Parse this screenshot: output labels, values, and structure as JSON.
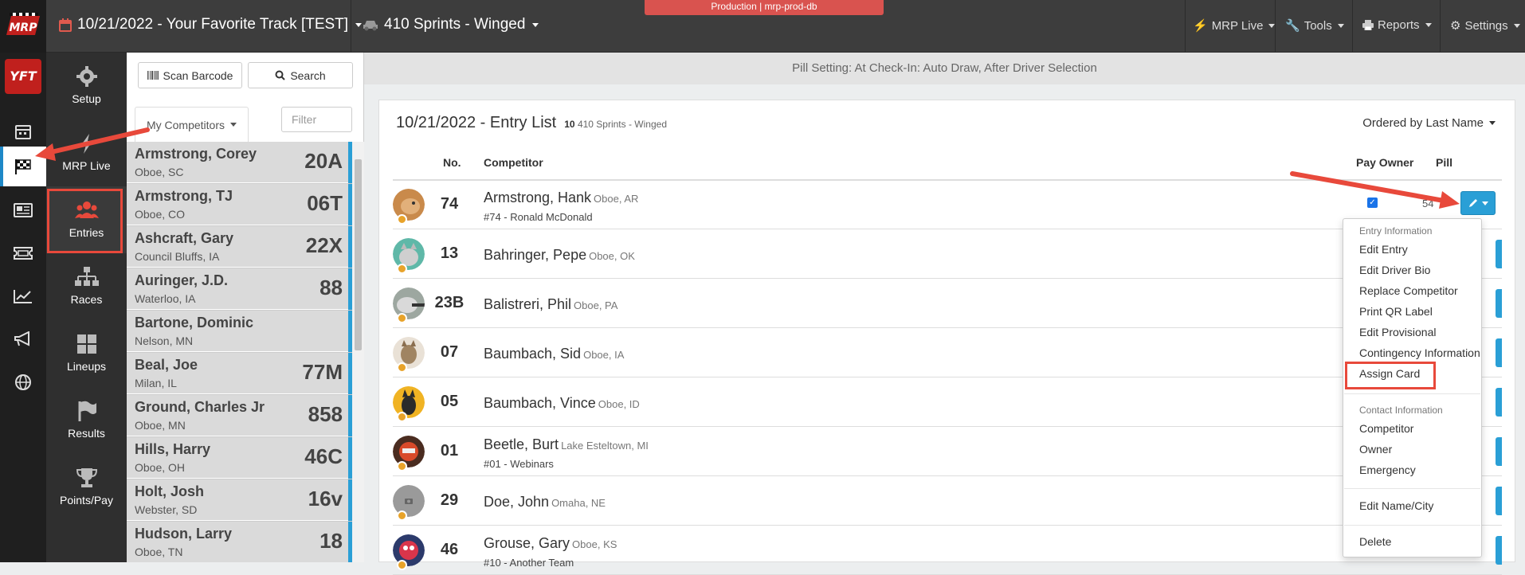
{
  "banner": "Production | mrp-prod-db",
  "topbar": {
    "event": "10/21/2022 - Your Favorite Track [TEST]",
    "division": "410 Sprints - Winged",
    "menus": [
      "MRP Live",
      "Tools",
      "Reports",
      "Settings"
    ]
  },
  "brand": {
    "logo_text": "MRP",
    "track_logo_text": "YFT"
  },
  "sidebar": {
    "items": [
      {
        "label": "Setup",
        "icon": "gear-icon"
      },
      {
        "label": "MRP Live",
        "icon": "bolt-icon"
      },
      {
        "label": "Entries",
        "icon": "users-icon"
      },
      {
        "label": "Races",
        "icon": "sitemap-icon"
      },
      {
        "label": "Lineups",
        "icon": "grid-icon"
      },
      {
        "label": "Results",
        "icon": "flag-icon"
      },
      {
        "label": "Points/Pay",
        "icon": "trophy-icon"
      }
    ]
  },
  "competitors": {
    "scan_label": "Scan Barcode",
    "search_label": "Search",
    "tab_label": "My Competitors",
    "filter_placeholder": "Filter",
    "list": [
      {
        "name": "Armstrong, Corey",
        "city": "Oboe, SC",
        "num": "20A"
      },
      {
        "name": "Armstrong, TJ",
        "city": "Oboe, CO",
        "num": "06T"
      },
      {
        "name": "Ashcraft, Gary",
        "city": "Council Bluffs, IA",
        "num": "22X"
      },
      {
        "name": "Auringer, J.D.",
        "city": "Waterloo, IA",
        "num": "88"
      },
      {
        "name": "Bartone, Dominic",
        "city": "Nelson, MN",
        "num": ""
      },
      {
        "name": "Beal, Joe",
        "city": "Milan, IL",
        "num": "77M"
      },
      {
        "name": "Ground, Charles Jr",
        "city": "Oboe, MN",
        "num": "858"
      },
      {
        "name": "Hills, Harry",
        "city": "Oboe, OH",
        "num": "46C"
      },
      {
        "name": "Holt, Josh",
        "city": "Webster, SD",
        "num": "16v"
      },
      {
        "name": "Hudson, Larry",
        "city": "Oboe, TN",
        "num": "18"
      }
    ]
  },
  "main": {
    "pill_setting": "Pill Setting: At Check-In: Auto Draw, After Driver Selection",
    "title": "10/21/2022 - Entry List",
    "count": "10",
    "division": "410 Sprints - Winged",
    "ordered": "Ordered by Last Name",
    "headers": {
      "no": "No.",
      "competitor": "Competitor",
      "pay_owner": "Pay Owner",
      "pill": "Pill"
    },
    "entries": [
      {
        "num": "74",
        "name": "Armstrong, Hank",
        "city": "Oboe, AR",
        "team": "#74 - Ronald McDonald",
        "pill": "54"
      },
      {
        "num": "13",
        "name": "Bahringer, Pepe",
        "city": "Oboe, OK",
        "team": ""
      },
      {
        "num": "23B",
        "name": "Balistreri, Phil",
        "city": "Oboe, PA",
        "team": ""
      },
      {
        "num": "07",
        "name": "Baumbach, Sid",
        "city": "Oboe, IA",
        "team": ""
      },
      {
        "num": "05",
        "name": "Baumbach, Vince",
        "city": "Oboe, ID",
        "team": ""
      },
      {
        "num": "01",
        "name": "Beetle, Burt",
        "city": "Lake Esteltown, MI",
        "team": "#01 - Webinars"
      },
      {
        "num": "29",
        "name": "Doe, John",
        "city": "Omaha, NE",
        "team": ""
      },
      {
        "num": "46",
        "name": "Grouse, Gary",
        "city": "Oboe, KS",
        "team": "#10 - Another Team"
      }
    ]
  },
  "dropdown": {
    "entry_header": "Entry Information",
    "entry_items": [
      "Edit Entry",
      "Edit Driver Bio",
      "Replace Competitor",
      "Print QR Label",
      "Edit Provisional",
      "Contingency Information",
      "Assign Card"
    ],
    "contact_header": "Contact Information",
    "contact_items": [
      "Competitor",
      "Owner",
      "Emergency"
    ],
    "edit_name": "Edit Name/City",
    "delete": "Delete"
  },
  "colors": {
    "accent": "#2a9fd6",
    "highlight": "#e8493b",
    "banner": "#d9534f"
  }
}
